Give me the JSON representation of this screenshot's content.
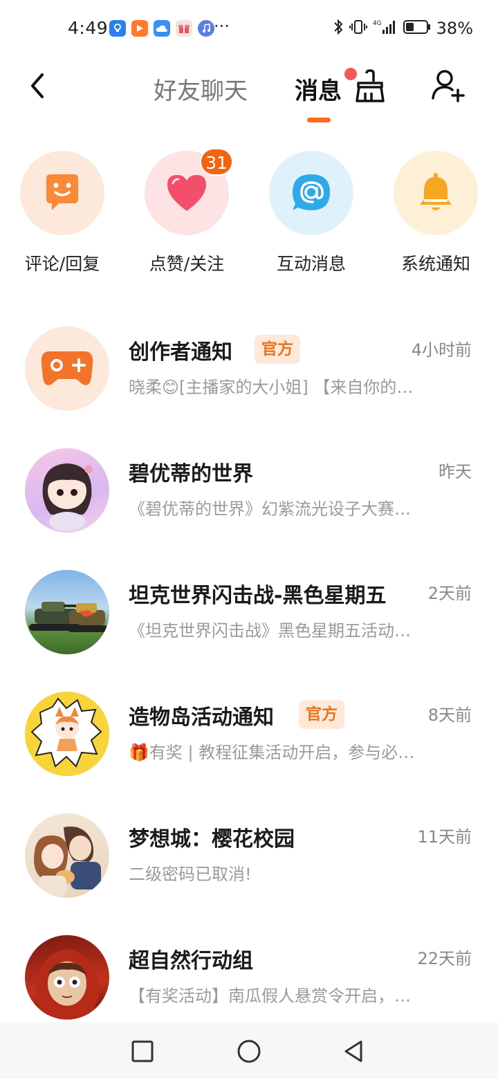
{
  "status_bar": {
    "time": "4:49",
    "more_glyph": "···",
    "battery_percent": "38%",
    "battery_level": 0.38,
    "app_icons": [
      "lightbulb-app-icon",
      "video-app-icon",
      "cloud-app-icon",
      "gift-app-icon",
      "music-app-icon"
    ]
  },
  "header": {
    "tab_friends": "好友聊天",
    "tab_messages": "消息",
    "active_tab": "消息",
    "accent_color": "#ff6a1a"
  },
  "categories": [
    {
      "label": "评论/回复",
      "icon": "comment-face-icon",
      "bg": "#fde8dc",
      "color": "#f88a3a"
    },
    {
      "label": "点赞/关注",
      "icon": "heart-icon",
      "bg": "#fde3e3",
      "color": "#f2506a",
      "badge": "31"
    },
    {
      "label": "互动消息",
      "icon": "at-sign-icon",
      "bg": "#dff2fc",
      "color": "#2ea9ea"
    },
    {
      "label": "系统通知",
      "icon": "bell-icon",
      "bg": "#fdf0d6",
      "color": "#f6a623"
    }
  ],
  "messages": [
    {
      "title": "创作者通知",
      "tag": "官方",
      "time": "4小时前",
      "preview": "晓柔😊[主播家的大小姐] 【来自你的…"
    },
    {
      "title": "碧优蒂的世界",
      "tag": "",
      "time": "昨天",
      "preview": "《碧优蒂的世界》幻紫流光设子大赛…"
    },
    {
      "title": "坦克世界闪击战-黑色星期五",
      "tag": "",
      "time": "2天前",
      "preview": "《坦克世界闪击战》黑色星期五活动…"
    },
    {
      "title": "造物岛活动通知",
      "tag": "官方",
      "time": "8天前",
      "preview": "🎁有奖 | 教程征集活动开启，参与必…"
    },
    {
      "title": "梦想城：樱花校园",
      "tag": "",
      "time": "11天前",
      "preview": "二级密码已取消!"
    },
    {
      "title": "超自然行动组",
      "tag": "",
      "time": "22天前",
      "preview": "【有奖活动】南瓜假人悬赏令开启，…"
    }
  ]
}
